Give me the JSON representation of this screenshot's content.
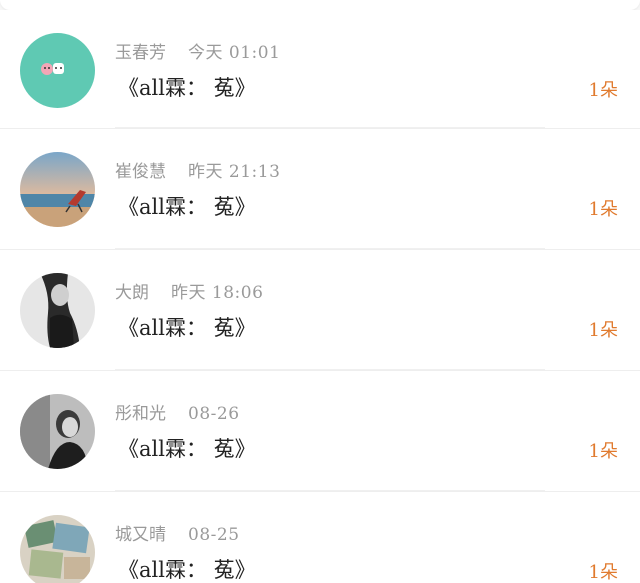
{
  "feed": {
    "items": [
      {
        "name": "玉春芳",
        "time": "今天 01:01",
        "content": "《all霖： 菟》",
        "count": "1朵",
        "avatar": "cute-sticker-avatar"
      },
      {
        "name": "崔俊慧",
        "time": "昨天 21:13",
        "content": "《all霖： 菟》",
        "count": "1朵",
        "avatar": "beach-chair-avatar"
      },
      {
        "name": "大朗",
        "time": "昨天 18:06",
        "content": "《all霖： 菟》",
        "count": "1朵",
        "avatar": "portrait-bw-avatar"
      },
      {
        "name": "彤和光",
        "time": "08-26",
        "content": "《all霖： 菟》",
        "count": "1朵",
        "avatar": "woman-bw-avatar"
      },
      {
        "name": "城又晴",
        "time": "08-25",
        "content": "《all霖： 菟》",
        "count": "1朵",
        "avatar": "photos-collage-avatar"
      }
    ]
  },
  "colors": {
    "accent": "#e07a2e",
    "avatar_teal": "#5fc9b3"
  }
}
